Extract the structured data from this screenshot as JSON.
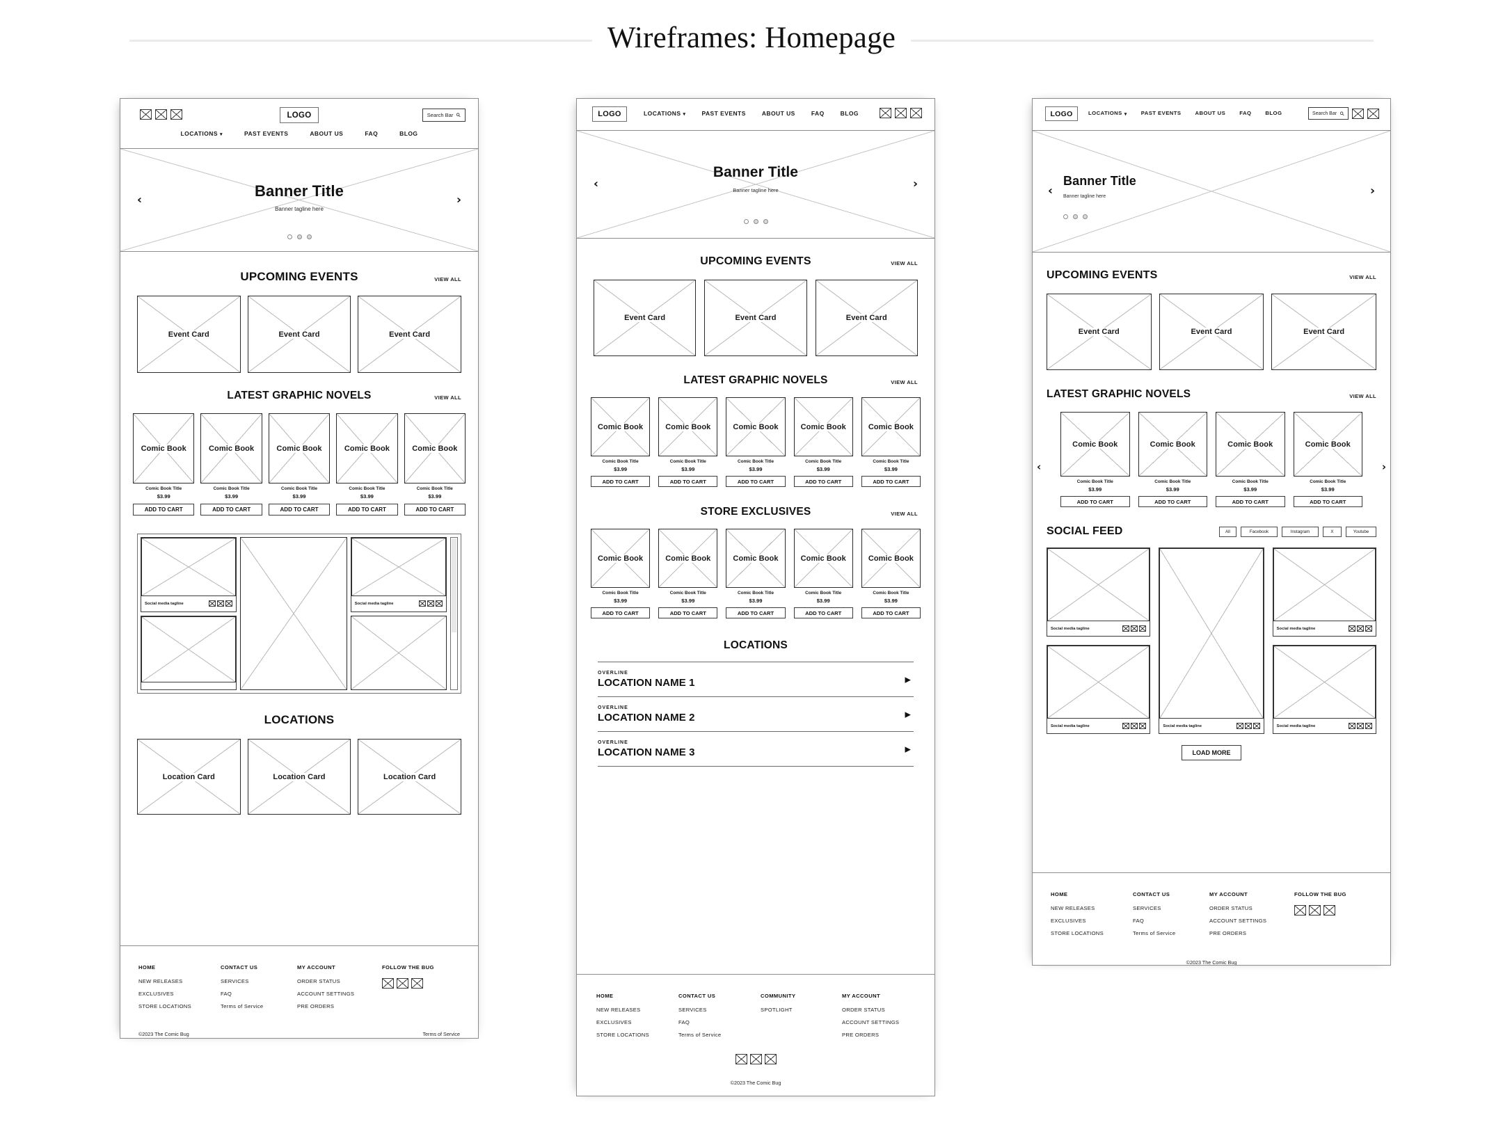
{
  "deck": {
    "title": "Wireframes: Homepage"
  },
  "nav": {
    "logo": "LOGO",
    "items": [
      "LOCATIONS",
      "PAST EVENTS",
      "ABOUT US",
      "FAQ",
      "BLOG"
    ],
    "locations_has_caret": true,
    "search_placeholder": "Search Bar",
    "icon_names": [
      "placeholder-icon-1",
      "placeholder-icon-2",
      "placeholder-icon-3"
    ]
  },
  "banner": {
    "title": "Banner Title",
    "tagline": "Banner tagline here",
    "prev": "‹",
    "next": "›",
    "dots": 3,
    "active_dot": 0
  },
  "sections": {
    "events": {
      "title": "UPCOMING EVENTS",
      "view_all": "VIEW ALL",
      "card_label": "Event Card",
      "count": 3
    },
    "novels": {
      "title": "LATEST GRAPHIC NOVELS",
      "view_all": "VIEW ALL",
      "card_label": "Comic Book"
    },
    "exclusives": {
      "title": "STORE EXCLUSIVES",
      "view_all": "VIEW ALL",
      "card_label": "Comic Book"
    },
    "locations_cards": {
      "title": "LOCATIONS",
      "card_label": "Location Card",
      "count": 3
    },
    "locations_list": {
      "title": "LOCATIONS",
      "rows": [
        {
          "overline": "OVERLINE",
          "name": "LOCATION NAME 1",
          "caret": "▶"
        },
        {
          "overline": "OVERLINE",
          "name": "LOCATION NAME 2",
          "caret": "▶"
        },
        {
          "overline": "OVERLINE",
          "name": "LOCATION NAME 3",
          "caret": "▶"
        }
      ]
    },
    "social": {
      "title": "SOCIAL FEED",
      "tagline": "Social media tagline",
      "filters": [
        "All",
        "Facebook",
        "Instagram",
        "X",
        "Youtube"
      ],
      "active_filter": "All",
      "load_more": "LOAD MORE"
    }
  },
  "product": {
    "title": "Comic Book Title",
    "price": "$3.99",
    "add_to_cart": "ADD TO CART"
  },
  "footer": {
    "col1": {
      "head": "HOME",
      "links": [
        "NEW RELEASES",
        "EXCLUSIVES",
        "STORE LOCATIONS"
      ]
    },
    "col2": {
      "head": "CONTACT US",
      "links": [
        "SERVICES",
        "FAQ",
        "Terms of Service"
      ]
    },
    "col3": {
      "head": "MY ACCOUNT",
      "links": [
        "ORDER STATUS",
        "ACCOUNT SETTINGS",
        "PRE ORDERS"
      ]
    },
    "col4": {
      "head": "FOLLOW THE BUG",
      "links": []
    },
    "community": {
      "head": "COMMUNITY",
      "links": [
        "SPOTLIGHT"
      ]
    },
    "my_account_b": {
      "head": "MY ACCOUNT",
      "links": [
        "ORDER STATUS",
        "ACCOUNT SETTINGS",
        "PRE ORDERS"
      ]
    },
    "copyright": "©2023 The Comic Bug",
    "terms": "Terms of Service"
  },
  "colors": {
    "frame_border": "#8c8c8c",
    "stroke": "#2b2b2b",
    "diagonal": "#bdbdbd",
    "rule": "#ebebeb"
  }
}
